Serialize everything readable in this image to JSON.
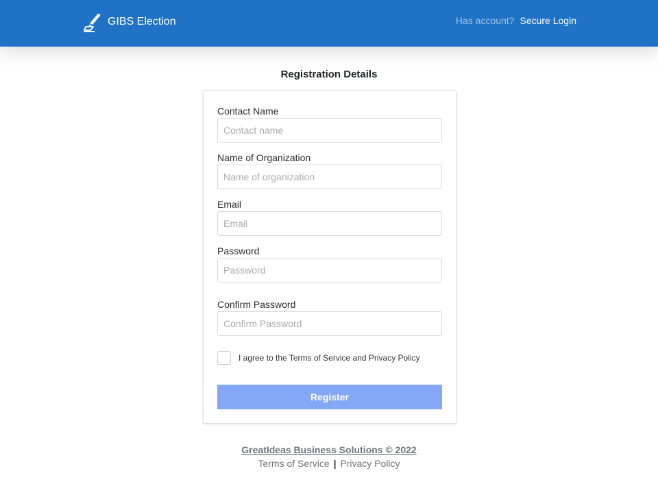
{
  "header": {
    "brand_name": "GIBS Election",
    "brand_icon": "ballot-pen-icon",
    "account_prompt": "Has account?",
    "login_label": "Secure Login",
    "bg_color": "#1f72c6"
  },
  "form": {
    "heading": "Registration Details",
    "fields": [
      {
        "label": "Contact Name",
        "placeholder": "Contact name",
        "value": ""
      },
      {
        "label": "Name of Organization",
        "placeholder": "Name of organization",
        "value": ""
      },
      {
        "label": "Email",
        "placeholder": "Email",
        "value": ""
      },
      {
        "label": "Password",
        "placeholder": "Password",
        "value": ""
      },
      {
        "label": "Confirm Password",
        "placeholder": "Confirm Password",
        "value": ""
      }
    ],
    "agree_label": "I agree to the Terms of Service and Privacy Policy",
    "agree_checked": false,
    "register_label": "Register",
    "register_color": "#84a7f6"
  },
  "footer": {
    "company": "GreatIdeas Business Solutions © 2022",
    "terms_label": "Terms of Service",
    "separator": "|",
    "privacy_label": "Privacy Policy"
  }
}
